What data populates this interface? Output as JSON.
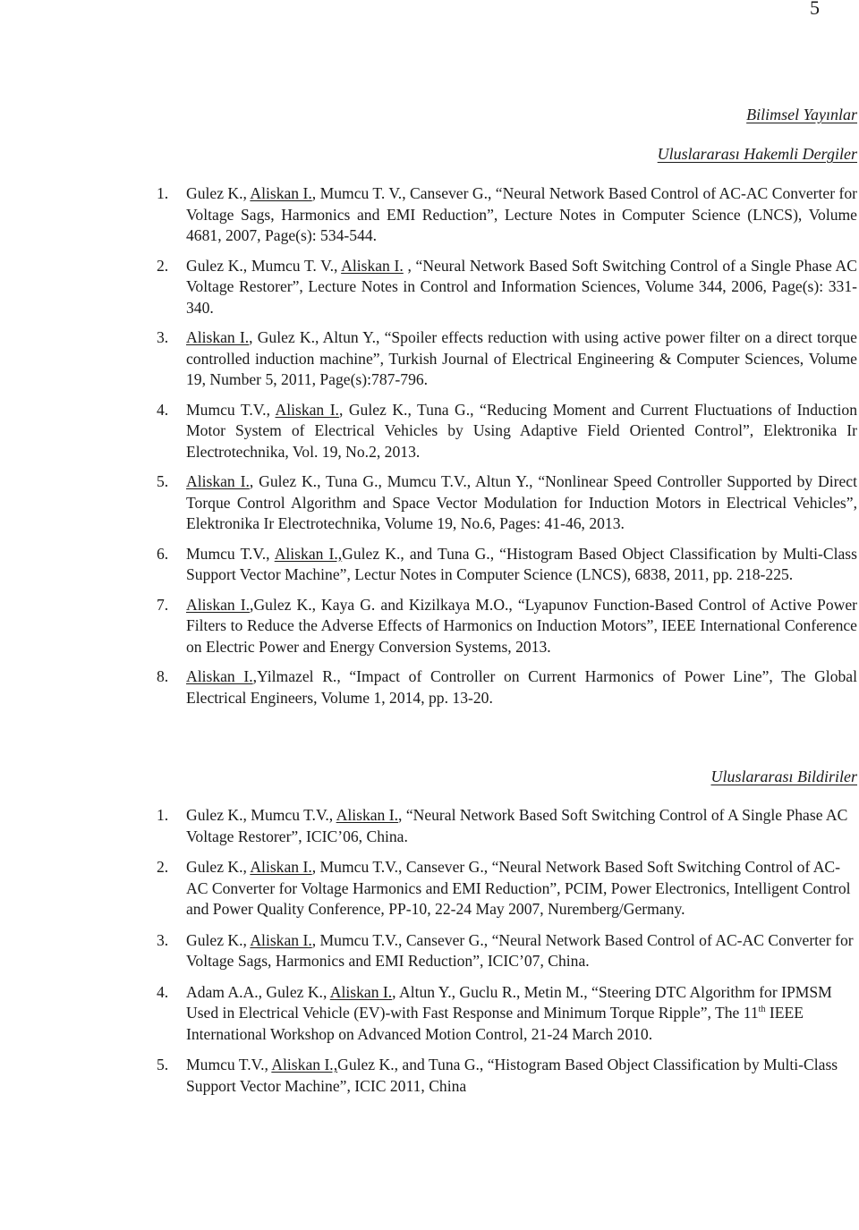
{
  "page_number": "5",
  "headings": {
    "scientific_publications": "Bilimsel Yayınlar",
    "international_journals": "Uluslararası Hakemli Dergiler",
    "international_conferences": "Uluslararası Bildiriler"
  },
  "journals": [
    {
      "num": "1.",
      "segments": [
        {
          "text": "Gulez K., ",
          "u": false
        },
        {
          "text": "Aliskan I.",
          "u": true
        },
        {
          "text": ", Mumcu T. V., Cansever G., “Neural Network Based Control of AC-AC Converter for Voltage Sags, Harmonics and EMI Reduction”, Lecture Notes in Computer Science (LNCS), Volume 4681, 2007, Page(s): 534-544.",
          "u": false
        }
      ]
    },
    {
      "num": "2.",
      "segments": [
        {
          "text": "Gulez K., Mumcu T. V., ",
          "u": false
        },
        {
          "text": "Aliskan I.",
          "u": true
        },
        {
          "text": " , “Neural Network Based Soft Switching Control of a Single Phase AC Voltage Restorer”, Lecture Notes in Control and Information Sciences, Volume 344, 2006, Page(s): 331-340.",
          "u": false
        }
      ]
    },
    {
      "num": "3.",
      "segments": [
        {
          "text": "Aliskan I.",
          "u": true
        },
        {
          "text": ", Gulez K., Altun Y., “Spoiler effects reduction with using active power filter on a direct torque controlled induction machine”, Turkish Journal of Electrical Engineering & Computer Sciences, Volume 19, Number 5, 2011, Page(s):787-796.",
          "u": false
        }
      ]
    },
    {
      "num": "4.",
      "segments": [
        {
          "text": "Mumcu T.V., ",
          "u": false
        },
        {
          "text": "Aliskan I.",
          "u": true
        },
        {
          "text": ", Gulez K., Tuna G., “Reducing Moment and Current Fluctuations of Induction Motor System of Electrical Vehicles by Using Adaptive Field Oriented Control”, Elektronika Ir Electrotechnika, Vol. 19, No.2, 2013.",
          "u": false
        }
      ]
    },
    {
      "num": "5.",
      "segments": [
        {
          "text": "Aliskan I.",
          "u": true
        },
        {
          "text": ", Gulez K., Tuna G., Mumcu T.V., Altun Y., “Nonlinear Speed Controller Supported by Direct Torque Control Algorithm and Space Vector Modulation for Induction Motors in Electrical Vehicles”, Elektronika Ir Electrotechnika, Volume 19, No.6, Pages: 41-46, 2013.",
          "u": false
        }
      ]
    },
    {
      "num": "6.",
      "segments": [
        {
          "text": "Mumcu T.V., ",
          "u": false
        },
        {
          "text": "Aliskan I.,",
          "u": true
        },
        {
          "text": "Gulez K., and Tuna G., “Histogram Based Object Classification by Multi-Class Support Vector Machine”, Lectur Notes in Computer Science (LNCS), 6838, 2011, pp. 218-225.",
          "u": false
        }
      ]
    },
    {
      "num": "7.",
      "segments": [
        {
          "text": "Aliskan I.",
          "u": true
        },
        {
          "text": ",Gulez K., Kaya G. and Kizilkaya M.O., “Lyapunov Function-Based Control of Active Power Filters to Reduce the Adverse Effects of Harmonics on Induction Motors”, IEEE International Conference on Electric Power and Energy Conversion Systems, 2013.",
          "u": false
        }
      ]
    },
    {
      "num": "8.",
      "segments": [
        {
          "text": "Aliskan I.",
          "u": true
        },
        {
          "text": ",Yilmazel R., “Impact of Controller on Current Harmonics of Power Line”, The Global Electrical Engineers, Volume 1, 2014, pp. 13-20.",
          "u": false
        }
      ]
    }
  ],
  "conferences": [
    {
      "num": "1.",
      "segments": [
        {
          "text": "Gulez K., Mumcu T.V., ",
          "u": false
        },
        {
          "text": "Aliskan I.",
          "u": true
        },
        {
          "text": ", “Neural Network Based Soft Switching Control of A Single Phase AC Voltage Restorer”, ICIC’06, China.",
          "u": false
        }
      ]
    },
    {
      "num": "2.",
      "segments": [
        {
          "text": "Gulez K., ",
          "u": false
        },
        {
          "text": "Aliskan I.",
          "u": true
        },
        {
          "text": ", Mumcu T.V., Cansever G., “Neural Network Based Soft Switching Control of AC-AC Converter for Voltage Harmonics and EMI Reduction”, PCIM, Power Electronics, Intelligent Control and Power Quality Conference, PP-10, 22-24 May 2007, Nuremberg/Germany.",
          "u": false
        }
      ]
    },
    {
      "num": "3.",
      "segments": [
        {
          "text": "Gulez K., ",
          "u": false
        },
        {
          "text": "Aliskan I.",
          "u": true
        },
        {
          "text": ", Mumcu T.V., Cansever G., “Neural Network Based Control of AC-AC Converter for Voltage Sags, Harmonics and EMI Reduction”, ICIC’07, China.",
          "u": false
        }
      ]
    },
    {
      "num": "4.",
      "segments": [
        {
          "text": "Adam A.A., Gulez K., ",
          "u": false
        },
        {
          "text": "Aliskan I.",
          "u": true
        },
        {
          "text": ", Altun Y., Guclu R., Metin M., “Steering DTC Algorithm for IPMSM Used in Electrical Vehicle (EV)-with Fast Response and Minimum Torque Ripple”, The 11",
          "u": false
        },
        {
          "text": "th",
          "sup": true
        },
        {
          "text": " IEEE International Workshop on Advanced Motion Control, 21-24 March 2010.",
          "u": false
        }
      ]
    },
    {
      "num": "5.",
      "segments": [
        {
          "text": "Mumcu T.V., ",
          "u": false
        },
        {
          "text": "Aliskan I.,",
          "u": true
        },
        {
          "text": "Gulez K., and Tuna G., “Histogram Based Object Classification by Multi-Class Support Vector Machine”, ICIC 2011, China",
          "u": false
        }
      ]
    }
  ]
}
